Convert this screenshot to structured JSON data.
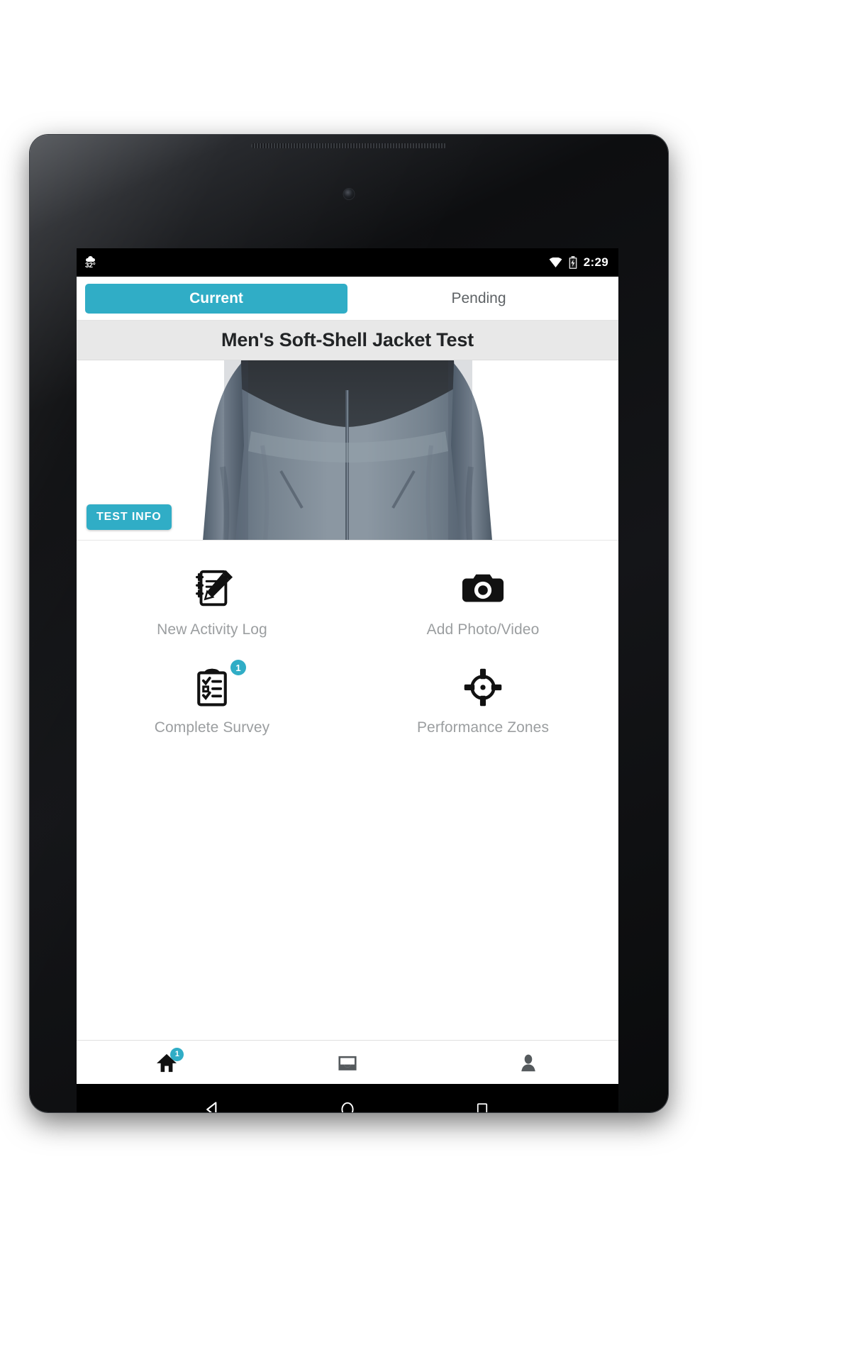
{
  "status_bar": {
    "weather_icon": "cloud-icon",
    "temperature": "32°",
    "wifi_icon": "wifi-icon",
    "battery_icon": "battery-charging-icon",
    "clock": "2:29"
  },
  "tabs": [
    {
      "label": "Current",
      "active": true
    },
    {
      "label": "Pending",
      "active": false
    }
  ],
  "header": {
    "title": "Men's Soft-Shell Jacket Test"
  },
  "hero": {
    "image_alt": "men's soft-shell jacket product photo",
    "badge_label": "TEST INFO"
  },
  "actions": [
    {
      "label": "New Activity Log",
      "icon": "notepad-pencil-icon",
      "badge": ""
    },
    {
      "label": "Add Photo/Video",
      "icon": "camera-icon",
      "badge": ""
    },
    {
      "label": "Complete Survey",
      "icon": "clipboard-check-icon",
      "badge": "1"
    },
    {
      "label": "Performance Zones",
      "icon": "crosshair-target-icon",
      "badge": ""
    }
  ],
  "bottom_nav": [
    {
      "name": "home",
      "icon": "home-icon",
      "badge": "1",
      "active": true
    },
    {
      "name": "inbox",
      "icon": "inbox-icon",
      "badge": "",
      "active": false
    },
    {
      "name": "profile",
      "icon": "person-icon",
      "badge": "",
      "active": false
    }
  ],
  "soft_nav": [
    {
      "name": "back",
      "icon": "triangle-back-icon"
    },
    {
      "name": "home",
      "icon": "circle-home-icon"
    },
    {
      "name": "recents",
      "icon": "square-recents-icon"
    }
  ],
  "colors": {
    "accent": "#30ADC6",
    "title_band": "#e8e8e8",
    "label_gray": "#9b9ea0"
  }
}
